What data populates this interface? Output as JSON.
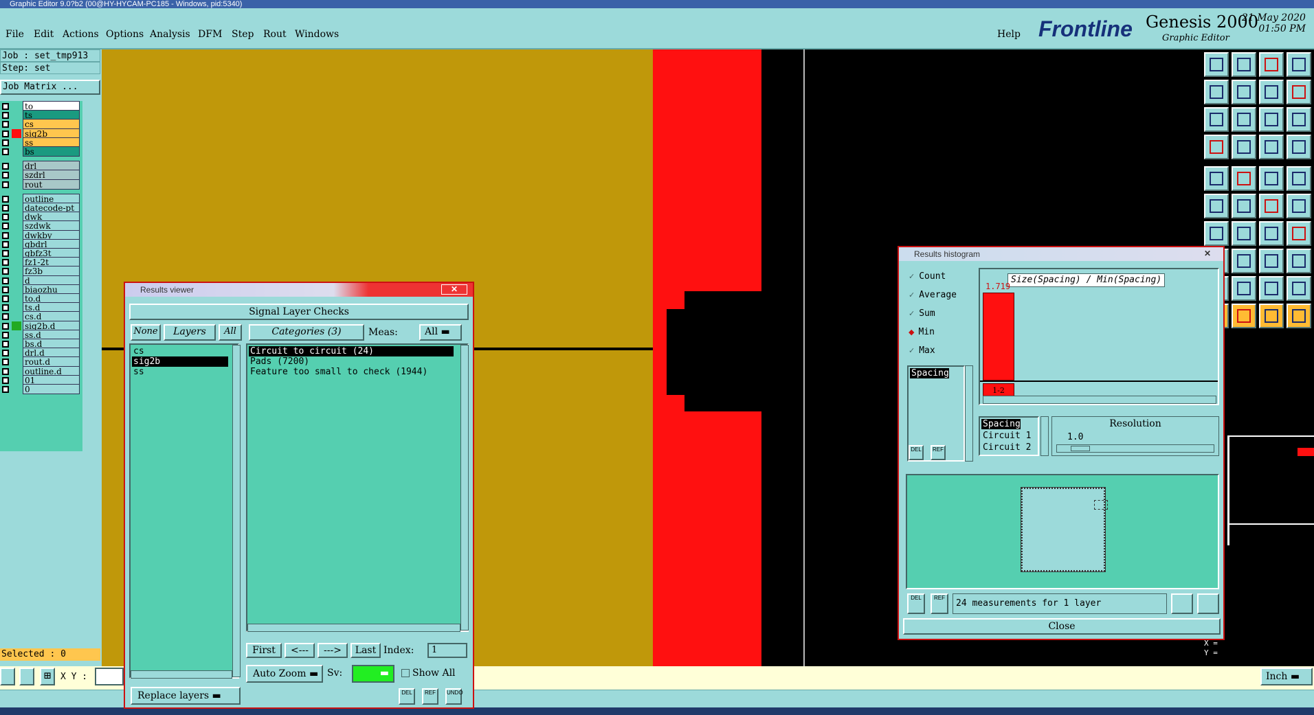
{
  "titlebar": {
    "text": "Graphic Editor 9.0?b2 (00@HY-HYCAM-PC185 - Windows, pid:5340)"
  },
  "menu": {
    "items": [
      "File",
      "Edit",
      "Actions",
      "Options",
      "Analysis",
      "DFM",
      "Step",
      "Rout",
      "Windows"
    ],
    "help": "Help"
  },
  "brand": {
    "logo": "Frontline",
    "product": "Genesis 2000",
    "subtitle": "Graphic Editor",
    "date": "21 May 2020",
    "time": "01:50 PM"
  },
  "left": {
    "job": "Job : set_tmp913",
    "step": "Step: set",
    "job_matrix": "Job Matrix ...",
    "selected": "Selected : 0",
    "layers": [
      {
        "name": "to",
        "bg": "#ffffff",
        "mark": ""
      },
      {
        "name": "ts",
        "bg": "#1a9a80",
        "mark": ""
      },
      {
        "name": "cs",
        "bg": "#ffc64e",
        "mark": ""
      },
      {
        "name": "sig2b",
        "bg": "#ffc64e",
        "mark": "#ff1010"
      },
      {
        "name": "ss",
        "bg": "#ffc64e",
        "mark": ""
      },
      {
        "name": "bs",
        "bg": "#1a9a80",
        "mark": ""
      },
      {
        "name": "drl",
        "bg": "#a8c8c8",
        "mark": ""
      },
      {
        "name": "szdrl",
        "bg": "#a8c8c8",
        "mark": ""
      },
      {
        "name": "rout",
        "bg": "#a8c8c8",
        "mark": ""
      },
      {
        "name": "outline",
        "bg": "#9cdada",
        "mark": ""
      },
      {
        "name": "datecode-pt",
        "bg": "#9cdada",
        "mark": ""
      },
      {
        "name": "dwk",
        "bg": "#9cdada",
        "mark": ""
      },
      {
        "name": "szdwk",
        "bg": "#9cdada",
        "mark": ""
      },
      {
        "name": "dwkby",
        "bg": "#9cdada",
        "mark": ""
      },
      {
        "name": "gbdrl",
        "bg": "#9cdada",
        "mark": ""
      },
      {
        "name": "gbfz3t",
        "bg": "#9cdada",
        "mark": ""
      },
      {
        "name": "fz1-2t",
        "bg": "#9cdada",
        "mark": ""
      },
      {
        "name": "fz3b",
        "bg": "#9cdada",
        "mark": ""
      },
      {
        "name": "d",
        "bg": "#9cdada",
        "mark": ""
      },
      {
        "name": "biaozhu",
        "bg": "#9cdada",
        "mark": ""
      },
      {
        "name": "to.d",
        "bg": "#9cdada",
        "mark": ""
      },
      {
        "name": "ts.d",
        "bg": "#9cdada",
        "mark": ""
      },
      {
        "name": "cs.d",
        "bg": "#9cdada",
        "mark": ""
      },
      {
        "name": "sig2b.d",
        "bg": "#9cdada",
        "mark": "#22aa22"
      },
      {
        "name": "ss.d",
        "bg": "#9cdada",
        "mark": ""
      },
      {
        "name": "bs.d",
        "bg": "#9cdada",
        "mark": ""
      },
      {
        "name": "drl.d",
        "bg": "#9cdada",
        "mark": ""
      },
      {
        "name": "rout.d",
        "bg": "#9cdada",
        "mark": ""
      },
      {
        "name": "outline.d",
        "bg": "#9cdada",
        "mark": ""
      },
      {
        "name": "01",
        "bg": "#9cdada",
        "mark": ""
      },
      {
        "name": "0",
        "bg": "#9cdada",
        "mark": ""
      }
    ]
  },
  "bottom": {
    "xy_label": "X Y :",
    "units": "Inch",
    "xlabel": "X =",
    "ylabel": "Y ="
  },
  "results_viewer": {
    "title": "Results viewer",
    "close": "✕",
    "header": "Signal Layer Checks",
    "none": "None",
    "layers_btn": "Layers",
    "all": "All",
    "categories": "Categories (3)",
    "meas_label": "Meas:",
    "meas_value": "All",
    "layer_items": [
      "cs",
      "sig2b",
      "ss"
    ],
    "selected_layer": 1,
    "category_items": [
      "Circuit to circuit (24)",
      "Pads (7200)",
      "Feature too small to check (1944)"
    ],
    "selected_category": 0,
    "first": "First",
    "prev": "<---",
    "next": "--->",
    "last": "Last",
    "index_label": "Index:",
    "index_value": "1",
    "auto_zoom": "Auto Zoom",
    "sv": "Sv:",
    "show_all": "Show All",
    "replace_layers": "Replace layers"
  },
  "histogram": {
    "title": "Results histogram",
    "modes": [
      "Count",
      "Average",
      "Sum",
      "Min",
      "Max"
    ],
    "selected_mode": "Min",
    "list_items": [
      "Spacing"
    ],
    "chart_title": "Size(Spacing) / Min(Spacing)",
    "attr_items": [
      "Spacing",
      "Circuit 1",
      "Circuit 2"
    ],
    "resolution_label": "Resolution",
    "resolution_value": "1.0",
    "summary": "24 measurements for 1 layer",
    "close": "Close",
    "chart_data": {
      "type": "bar",
      "categories": [
        "1-2"
      ],
      "values": [
        1.719
      ],
      "bar_labels": [
        "1.719"
      ]
    }
  }
}
